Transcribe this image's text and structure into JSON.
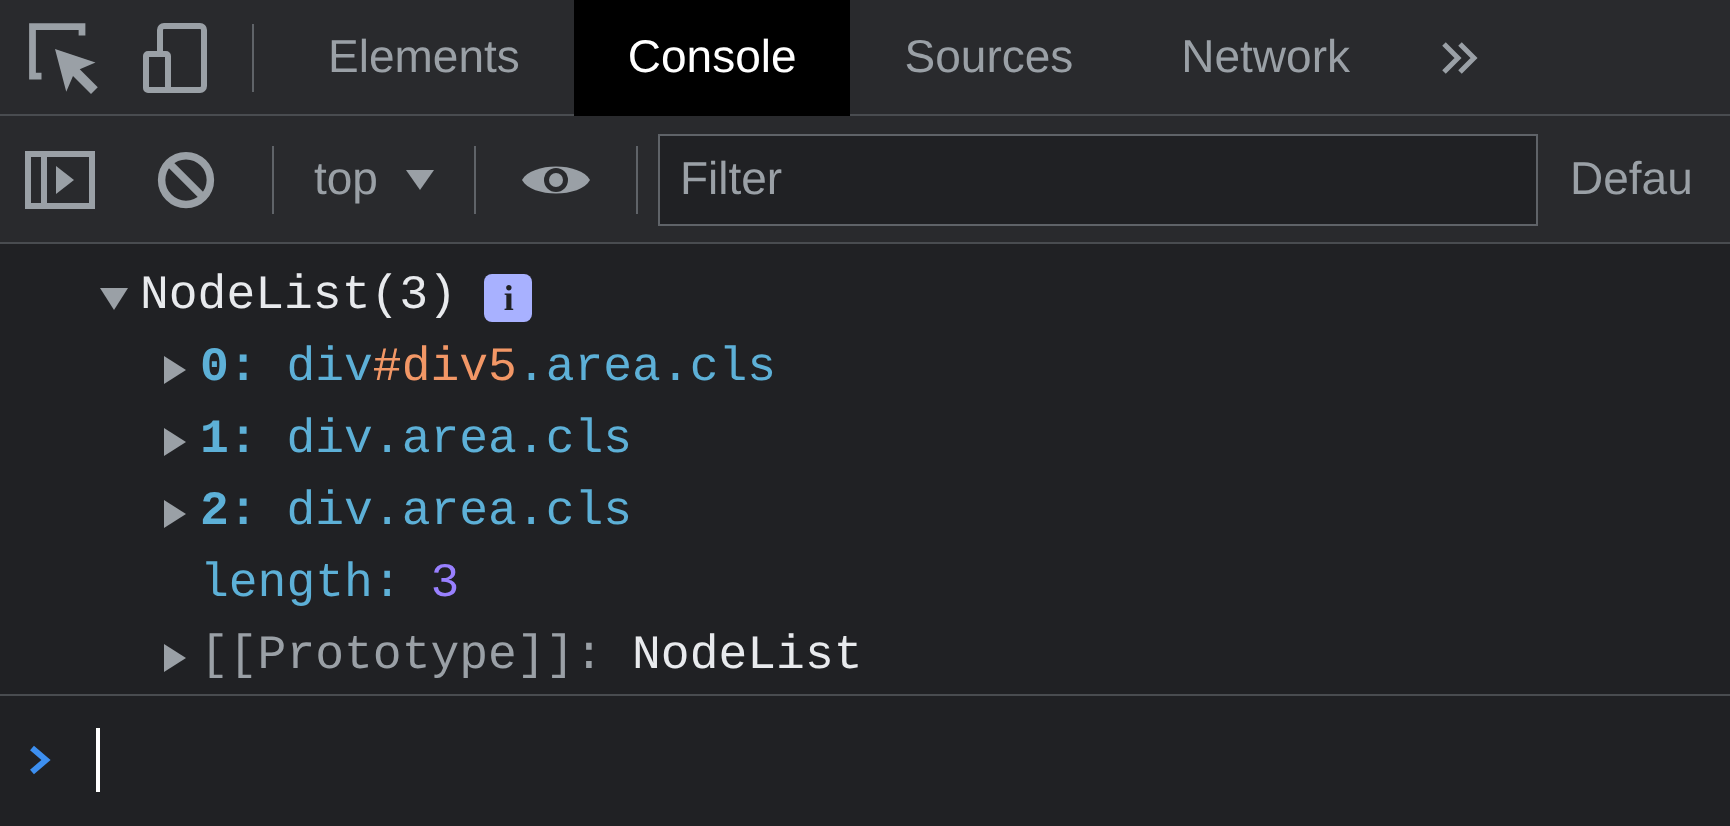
{
  "tabs": [
    {
      "label": "Elements",
      "selected": false
    },
    {
      "label": "Console",
      "selected": true
    },
    {
      "label": "Sources",
      "selected": false
    },
    {
      "label": "Network",
      "selected": false
    }
  ],
  "toolbar": {
    "context": "top",
    "filter": {
      "placeholder": "Filter"
    },
    "levels": "Defau"
  },
  "console": {
    "object": {
      "label": "NodeList(3)",
      "expanded": true,
      "info": "i",
      "properties": [
        {
          "kind": "index",
          "key": "0:",
          "expanded": false,
          "value": [
            {
              "kind": "tag",
              "text": "div"
            },
            {
              "kind": "id",
              "text": "#div5"
            },
            {
              "kind": "class",
              "text": ".area.cls"
            }
          ]
        },
        {
          "kind": "index",
          "key": "1:",
          "expanded": false,
          "value": [
            {
              "kind": "tag",
              "text": "div"
            },
            {
              "kind": "class",
              "text": ".area.cls"
            }
          ]
        },
        {
          "kind": "index",
          "key": "2:",
          "expanded": false,
          "value": [
            {
              "kind": "tag",
              "text": "div"
            },
            {
              "kind": "class",
              "text": ".area.cls"
            }
          ]
        },
        {
          "kind": "length",
          "key": "length:",
          "value": [
            {
              "kind": "number",
              "text": "3"
            }
          ]
        },
        {
          "kind": "prototype",
          "key": "[[Prototype]]:",
          "expanded": false,
          "value": [
            {
              "kind": "plain",
              "text": "NodeList"
            }
          ]
        }
      ]
    }
  }
}
